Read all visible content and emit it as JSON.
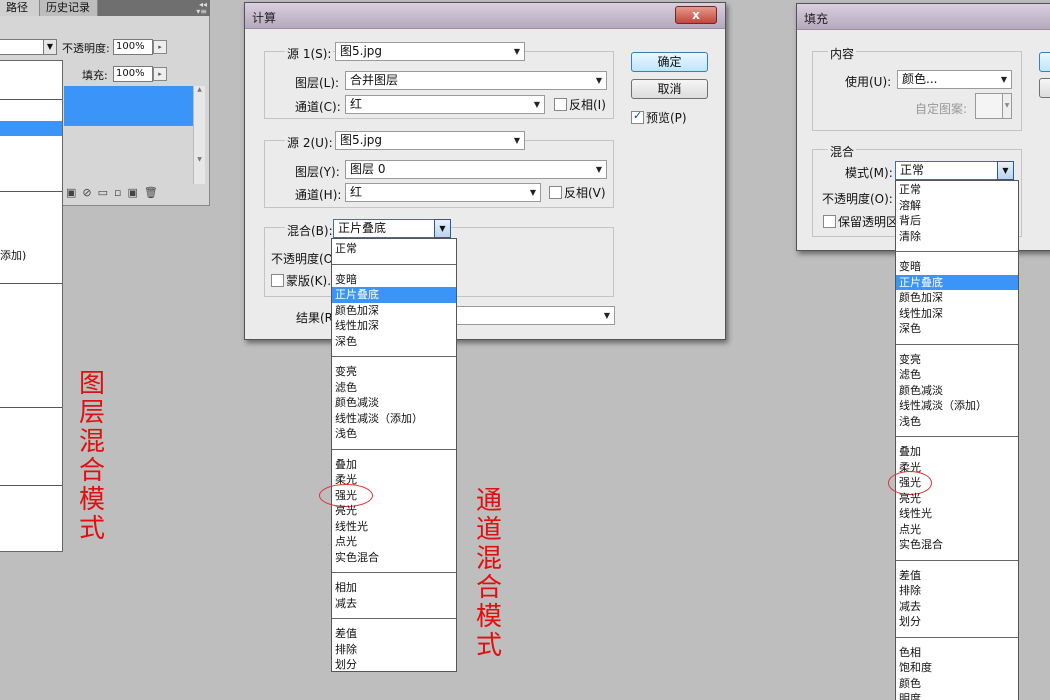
{
  "layers_panel": {
    "tabs": [
      "路径",
      "历史记录"
    ],
    "opacity_label": "不透明度:",
    "opacity_value": "100%",
    "fill_label": "填充:",
    "fill_value": "100%"
  },
  "layer_menu": {
    "visible_text": "添加)"
  },
  "captions": {
    "layer": "图层混合模式",
    "channel": "通道混合模式"
  },
  "calc_dialog": {
    "title": "计算",
    "close": "x",
    "ok": "确定",
    "cancel": "取消",
    "preview": "预览(P)",
    "source1_label": "源 1(S):",
    "source1_value": "图5.jpg",
    "layer1_label": "图层(L):",
    "layer1_value": "合并图层",
    "channel1_label": "通道(C):",
    "channel1_value": "红",
    "invert1": "反相(I)",
    "source2_label": "源 2(U):",
    "source2_value": "图5.jpg",
    "layer2_label": "图层(Y):",
    "layer2_value": "图层 0",
    "channel2_label": "通道(H):",
    "channel2_value": "红",
    "invert2": "反相(V)",
    "blend_label": "混合(B):",
    "blend_value": "正片叠底",
    "opacity_label": "不透明度(O",
    "mask_label": "蒙版(K)..",
    "result_label": "结果(R"
  },
  "calc_blend_list": {
    "groups": [
      [
        "正常"
      ],
      [
        "变暗",
        "正片叠底",
        "颜色加深",
        "线性加深",
        "深色"
      ],
      [
        "变亮",
        "滤色",
        "颜色减淡",
        "线性减淡（添加）",
        "浅色"
      ],
      [
        "叠加",
        "柔光",
        "强光",
        "亮光",
        "线性光",
        "点光",
        "实色混合"
      ],
      [
        "相加",
        "减去"
      ],
      [
        "差值",
        "排除",
        "划分"
      ]
    ],
    "selected": "正片叠底",
    "circled": "强光"
  },
  "fill_dialog": {
    "title": "填充",
    "content_group": "内容",
    "use_label": "使用(U):",
    "use_value": "颜色...",
    "custom_pattern_label": "自定图案:",
    "blend_group": "混合",
    "mode_label": "模式(M):",
    "mode_value": "正常",
    "opacity_label": "不透明度(O):",
    "preserve_label": "保留透明区"
  },
  "fill_mode_list": {
    "groups": [
      [
        "正常",
        "溶解",
        "背后",
        "清除"
      ],
      [
        "变暗",
        "正片叠底",
        "颜色加深",
        "线性加深",
        "深色"
      ],
      [
        "变亮",
        "滤色",
        "颜色减淡",
        "线性减淡（添加）",
        "浅色"
      ],
      [
        "叠加",
        "柔光",
        "强光",
        "亮光",
        "线性光",
        "点光",
        "实色混合"
      ],
      [
        "差值",
        "排除",
        "减去",
        "划分"
      ],
      [
        "色相",
        "饱和度",
        "颜色",
        "明度"
      ]
    ],
    "selected": "正片叠底",
    "circled": "强光"
  },
  "colors": {
    "selection": "#3b94f8",
    "caption_red": "#e01010",
    "background": "#bebebe"
  }
}
